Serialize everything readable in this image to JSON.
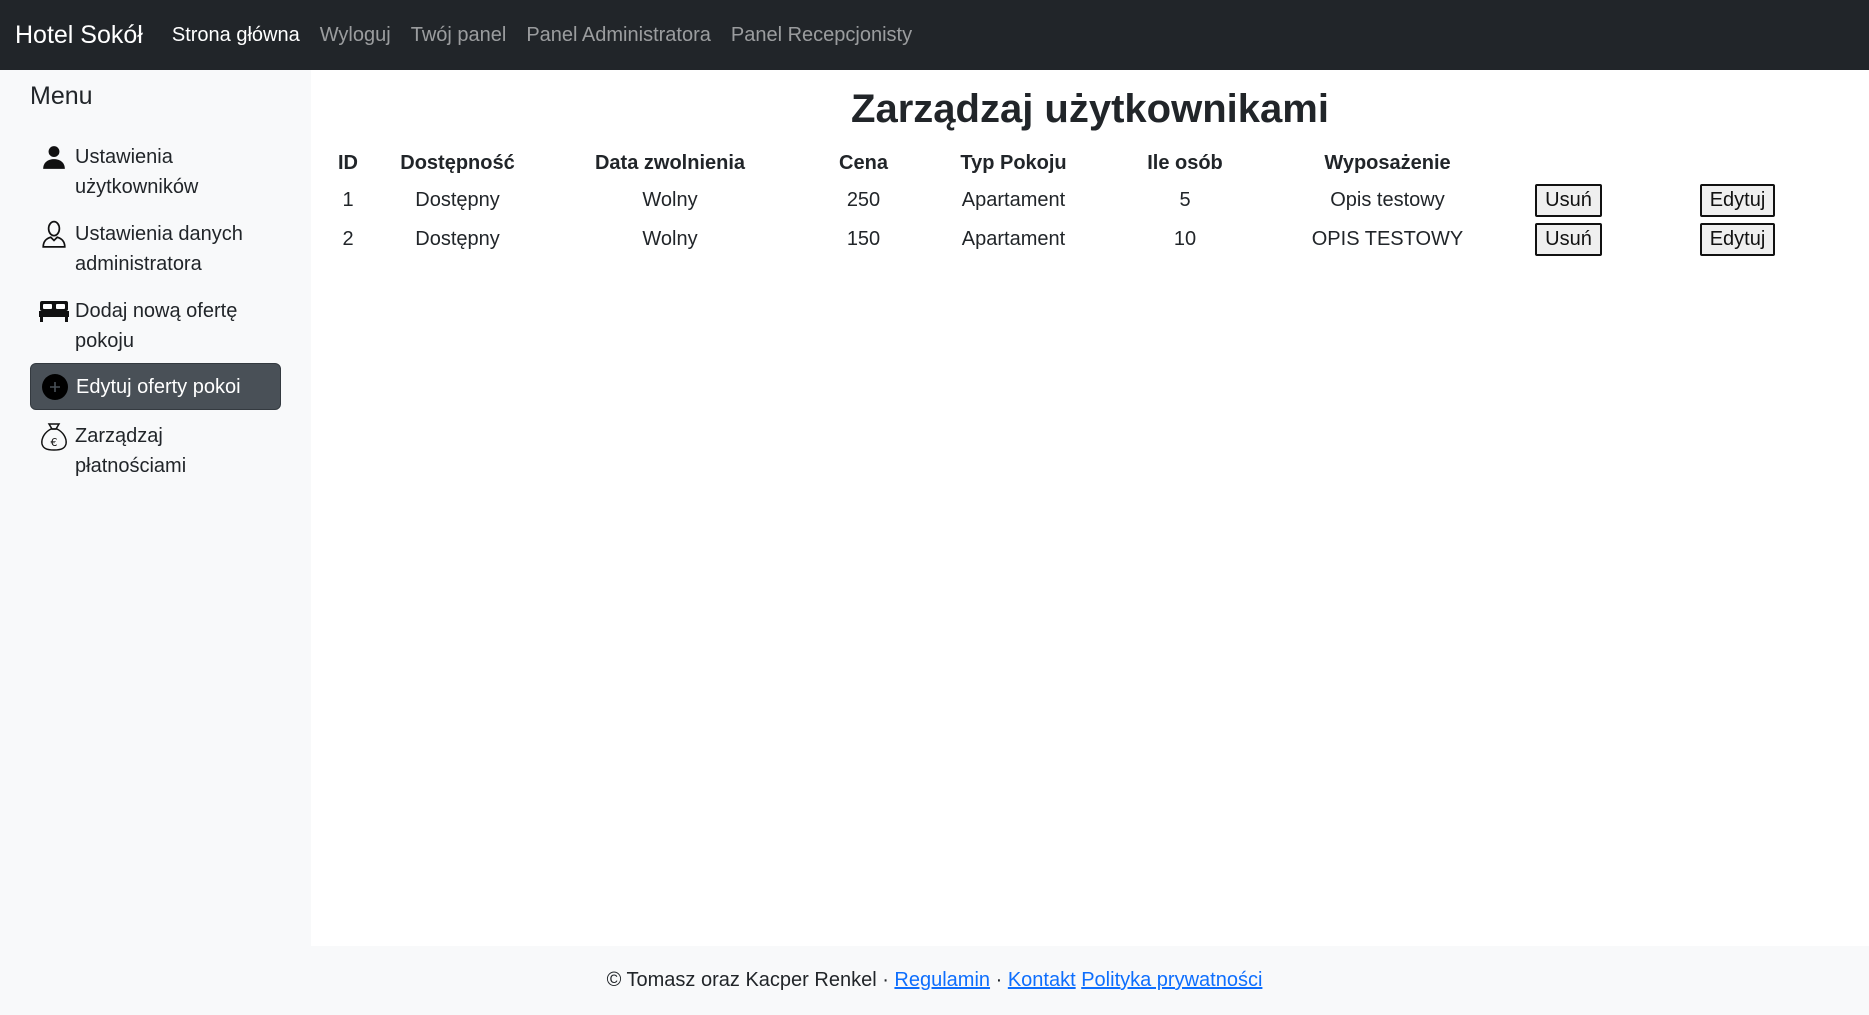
{
  "navbar": {
    "brand": "Hotel Sokół",
    "links": [
      {
        "label": "Strona główna",
        "active": true
      },
      {
        "label": "Wyloguj",
        "active": false
      },
      {
        "label": "Twój panel",
        "active": false
      },
      {
        "label": "Panel Administratora",
        "active": false
      },
      {
        "label": "Panel Recepcjonisty",
        "active": false
      }
    ]
  },
  "sidebar": {
    "title": "Menu",
    "items": [
      {
        "label": "Ustawienia użytkowników",
        "icon": "user-icon"
      },
      {
        "label": "Ustawienia danych administratora",
        "icon": "user-outline-icon"
      },
      {
        "label": "Dodaj nową ofertę pokoju",
        "icon": "bed-icon"
      },
      {
        "label": "Edytuj oferty pokoi",
        "icon": "plus-circle-icon",
        "active": true
      },
      {
        "label": "Zarządzaj płatnościami",
        "icon": "money-bag-icon"
      }
    ]
  },
  "main": {
    "title": "Zarządzaj użytkownikami",
    "columns": [
      "ID",
      "Dostępność",
      "Data zwolnienia",
      "Cena",
      "Typ Pokoju",
      "Ile osób",
      "Wyposażenie"
    ],
    "rows": [
      {
        "id": "1",
        "dostepnosc": "Dostępny",
        "data": "Wolny",
        "cena": "250",
        "typ": "Apartament",
        "osob": "5",
        "wyposazenie": "Opis testowy"
      },
      {
        "id": "2",
        "dostepnosc": "Dostępny",
        "data": "Wolny",
        "cena": "150",
        "typ": "Apartament",
        "osob": "10",
        "wyposazenie": "OPIS TESTOWY"
      }
    ],
    "delete_label": "Usuń",
    "edit_label": "Edytuj"
  },
  "footer": {
    "copyright": "© Tomasz oraz Kacper Renkel ·",
    "regulamin": "Regulamin",
    "sep": "·",
    "kontakt": "Kontakt",
    "polityka": "Polityka prywatności"
  },
  "colors": {
    "navbar_bg": "#212529",
    "sidebar_bg": "#f8f9fa",
    "active_item_bg": "#495057",
    "link": "#0d6efd"
  }
}
